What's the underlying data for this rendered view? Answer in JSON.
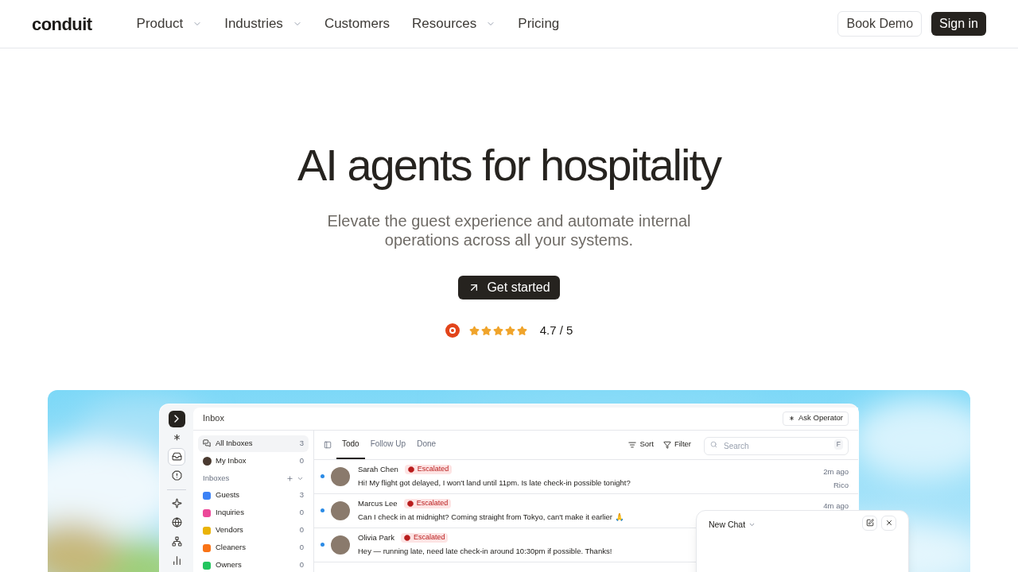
{
  "nav": {
    "logo": "conduit",
    "links": [
      {
        "label": "Product",
        "has_menu": true
      },
      {
        "label": "Industries",
        "has_menu": true
      },
      {
        "label": "Customers",
        "has_menu": false
      },
      {
        "label": "Resources",
        "has_menu": true
      },
      {
        "label": "Pricing",
        "has_menu": false
      }
    ],
    "book_demo": "Book Demo",
    "sign_in": "Sign in"
  },
  "hero": {
    "title": "AI agents for hospitality",
    "subtitle": "Elevate the guest experience and automate internal operations across all your systems.",
    "cta": "Get started",
    "stars": 5,
    "score": "4.7 / 5"
  },
  "app": {
    "title": "Inbox",
    "ask": "Ask Operator",
    "rail": [
      {
        "kind": "asterisk",
        "selected": false
      },
      {
        "kind": "inbox",
        "selected": true
      },
      {
        "kind": "alert",
        "selected": false
      },
      {
        "kind": "sparkle",
        "selected": false
      },
      {
        "kind": "globe",
        "selected": false
      },
      {
        "kind": "network",
        "selected": false
      },
      {
        "kind": "chart",
        "selected": false
      }
    ],
    "views": [
      {
        "kind": "all",
        "label": "All Inboxes",
        "count": "3",
        "selected": true
      },
      {
        "kind": "mine",
        "label": "My Inbox",
        "count": "0",
        "selected": false
      }
    ],
    "inboxes_heading": "Inboxes",
    "inboxes": [
      {
        "label": "Guests",
        "count": "3",
        "color": "#3b82f6"
      },
      {
        "label": "Inquiries",
        "count": "0",
        "color": "#ec4899"
      },
      {
        "label": "Vendors",
        "count": "0",
        "color": "#eab308"
      },
      {
        "label": "Cleaners",
        "count": "0",
        "color": "#f97316"
      },
      {
        "label": "Owners",
        "count": "0",
        "color": "#22c55e"
      }
    ],
    "tabs": [
      {
        "label": "Todo",
        "selected": true
      },
      {
        "label": "Follow Up",
        "selected": false
      },
      {
        "label": "Done",
        "selected": false
      }
    ],
    "sort": "Sort",
    "filter": "Filter",
    "search": {
      "placeholder": "Search"
    },
    "shortcut": "F",
    "conversations": [
      {
        "name": "Sarah Chen",
        "badge": "Escalated",
        "message": "Hi! My flight got delayed, I won't land until 11pm. Is late check-in possible tonight?",
        "time": "2m ago",
        "assignee": "Rico",
        "unread": true
      },
      {
        "name": "Marcus Lee",
        "badge": "Escalated",
        "message": "Can I check in at midnight? Coming straight from Tokyo, can't make it earlier 🙏",
        "time": "4m ago",
        "unread": true
      },
      {
        "name": "Olivia Park",
        "badge": "Escalated",
        "message": "Hey — running late, need late check-in around 10:30pm if possible. Thanks!",
        "unread": true
      }
    ],
    "chat": {
      "title": "New Chat"
    }
  }
}
